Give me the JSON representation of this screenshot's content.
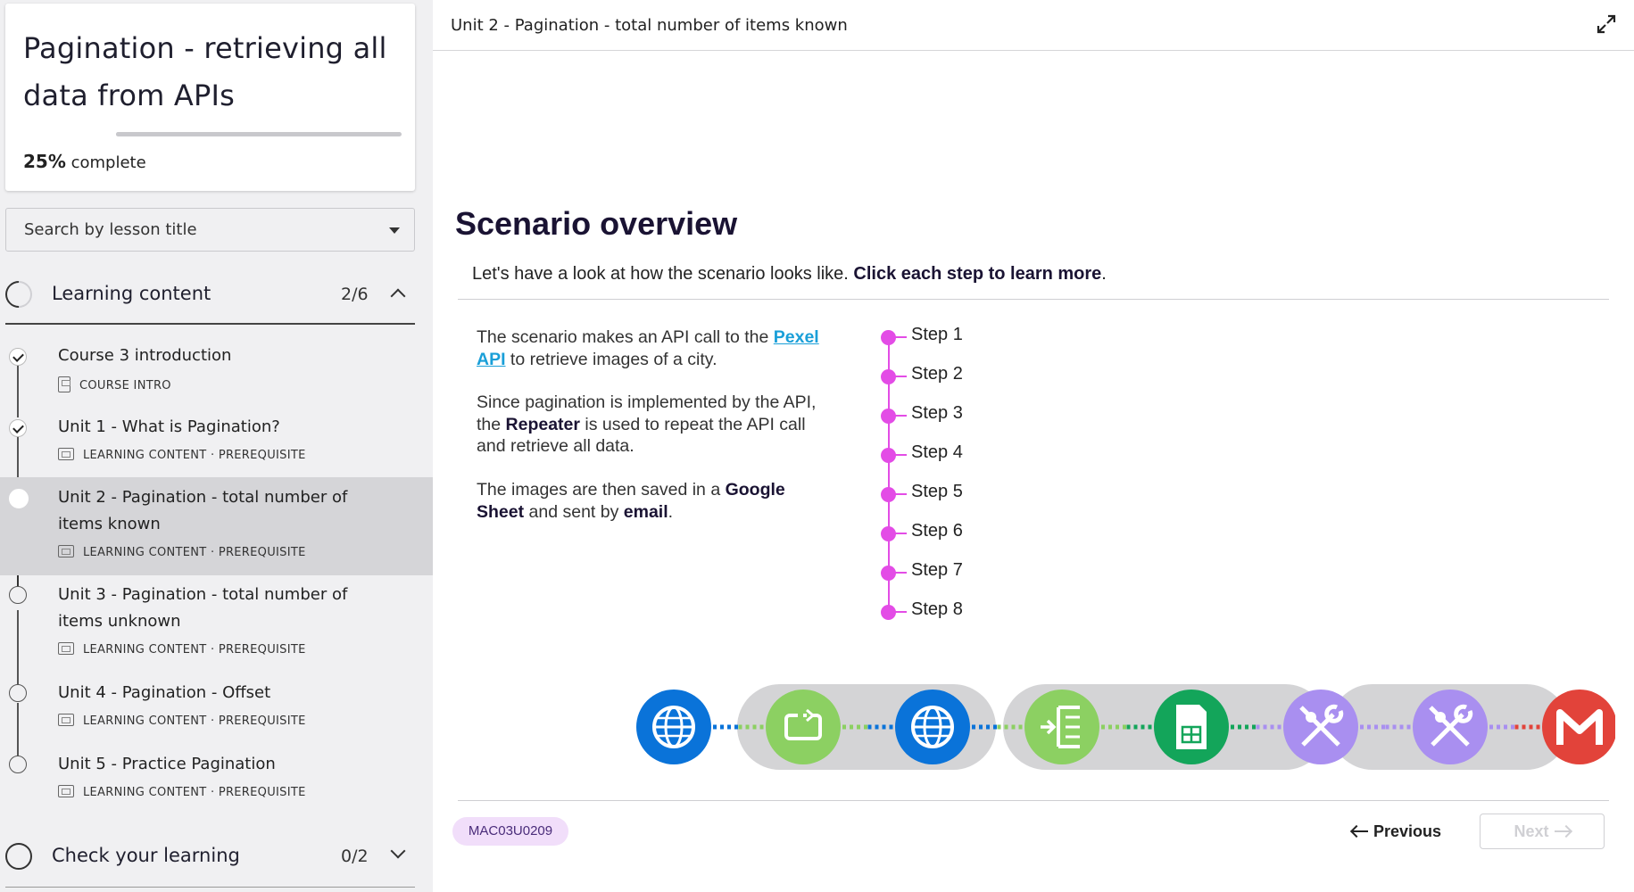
{
  "sidebar": {
    "course_title": "Pagination - retrieving all data from APIs",
    "progress": {
      "percent_value": 25,
      "percent": "25%",
      "suffix": "complete"
    },
    "search_placeholder": "Search by lesson title",
    "sections": [
      {
        "label": "Learning content",
        "count": "2/6",
        "expanded": true,
        "lessons": [
          {
            "title": "Course 3 introduction",
            "meta": "COURSE INTRO",
            "status": "done"
          },
          {
            "title": "Unit 1 - What is Pagination?",
            "meta": "LEARNING CONTENT · PREREQUISITE",
            "status": "done"
          },
          {
            "title": "Unit 2 - Pagination - total number of items known",
            "meta": "LEARNING CONTENT · PREREQUISITE",
            "status": "current"
          },
          {
            "title": "Unit 3 - Pagination - total number of items unknown",
            "meta": "LEARNING CONTENT · PREREQUISITE",
            "status": "open"
          },
          {
            "title": "Unit 4 - Pagination - Offset",
            "meta": "LEARNING CONTENT · PREREQUISITE",
            "status": "open"
          },
          {
            "title": "Unit 5 - Practice Pagination",
            "meta": "LEARNING CONTENT · PREREQUISITE",
            "status": "open"
          }
        ]
      },
      {
        "label": "Check your learning",
        "count": "0/2",
        "expanded": false
      }
    ]
  },
  "main": {
    "breadcrumb": "Unit 2 - Pagination - total number of items known",
    "heading": "Scenario overview",
    "intro": {
      "text": "Let's have a look at how the scenario looks like. ",
      "bold": "Click each step to learn more",
      "end": "."
    },
    "description": {
      "p1_a": "The scenario makes an API call to the ",
      "p1_link": "Pexel API",
      "p1_b": " to retrieve images of a city.",
      "p2_a": "Since pagination is implemented by the API, the ",
      "p2_bold": "Repeater",
      "p2_b": " is used to repeat the API call and retrieve all data.",
      "p3_a": "The images are then saved in a ",
      "p3_bold1": "Google Sheet",
      "p3_b": " and sent by ",
      "p3_bold2": "email",
      "p3_c": "."
    },
    "steps": [
      "Step 1",
      "Step 2",
      "Step 3",
      "Step 4",
      "Step 5",
      "Step 6",
      "Step 7",
      "Step 8"
    ],
    "modules": [
      {
        "icon": "http-globe-icon",
        "color": "#0a73d9"
      },
      {
        "icon": "repeater-icon",
        "color": "#8cd062"
      },
      {
        "icon": "http-globe-icon",
        "color": "#0a73d9"
      },
      {
        "icon": "iterator-icon",
        "color": "#8cd062"
      },
      {
        "icon": "google-sheets-icon",
        "color": "#13a55a"
      },
      {
        "icon": "tools-icon",
        "color": "#a98ff0"
      },
      {
        "icon": "tools-icon",
        "color": "#a98ff0"
      },
      {
        "icon": "gmail-icon",
        "color": "#e2433a"
      }
    ],
    "footer": {
      "code": "MAC03U0209",
      "previous": "Previous",
      "next": "Next"
    }
  },
  "colors": {
    "accent_step": "#e34ce6",
    "badge_bg": "#f1defa",
    "link": "#1a9fd8"
  }
}
